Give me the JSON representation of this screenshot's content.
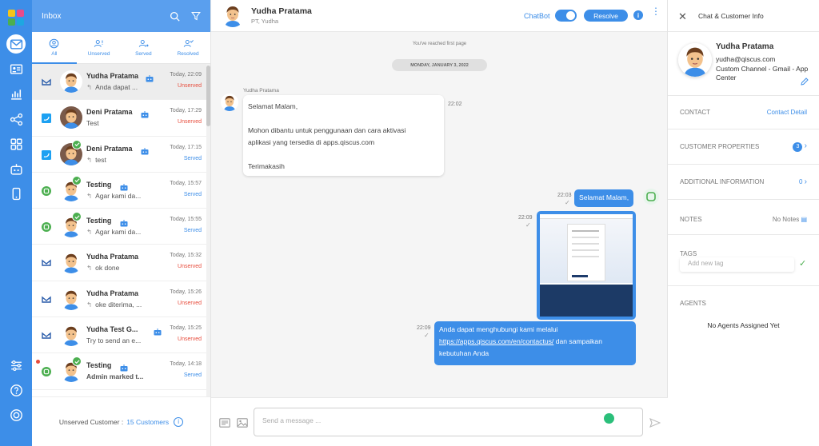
{
  "inbox": {
    "title": "Inbox",
    "tabs": [
      {
        "label": "All"
      },
      {
        "label": "Unserved"
      },
      {
        "label": "Served"
      },
      {
        "label": "Resolved"
      }
    ],
    "rows": [
      {
        "name": "Yudha Pratama",
        "channel": "gmail",
        "time": "Today, 22:09",
        "preview": "Anda dapat ...",
        "status": "Unserved",
        "reply": true,
        "selected": true,
        "bot": true
      },
      {
        "name": "Deni Pratama",
        "channel": "twitter",
        "time": "Today, 17:29",
        "preview": "Test",
        "status": "Unserved",
        "reply": false,
        "bot": true
      },
      {
        "name": "Deni Pratama",
        "channel": "twitter",
        "time": "Today, 17:15",
        "preview": "test",
        "status": "Served",
        "reply": true,
        "bot": true,
        "checked": true
      },
      {
        "name": "Testing",
        "channel": "custom",
        "time": "Today, 15:57",
        "preview": "Agar kami da...",
        "status": "Served",
        "reply": true,
        "bot": true,
        "checked": true
      },
      {
        "name": "Testing",
        "channel": "custom",
        "time": "Today, 15:55",
        "preview": "Agar kami da...",
        "status": "Served",
        "reply": true,
        "bot": true,
        "checked": true
      },
      {
        "name": "Yudha Pratama",
        "channel": "gmail",
        "time": "Today, 15:32",
        "preview": "ok done",
        "status": "Unserved",
        "reply": true,
        "bot": false
      },
      {
        "name": "Yudha Pratama",
        "channel": "gmail",
        "time": "Today, 15:26",
        "preview": "oke diterima, ...",
        "status": "Unserved",
        "reply": true,
        "bot": false
      },
      {
        "name": "Yudha Test G...",
        "channel": "gmail",
        "time": "Today, 15:25",
        "preview": "Try to send an e...",
        "status": "Unserved",
        "reply": false,
        "bot": true
      },
      {
        "name": "Testing",
        "channel": "custom",
        "time": "Today, 14:18",
        "preview": "Admin marked t...",
        "status": "Served",
        "reply": false,
        "bot": true,
        "checked": true,
        "dot": true,
        "boldPreview": true
      }
    ],
    "footer": {
      "label": "Unserved Customer :",
      "count": "15 Customers",
      "info": "i"
    }
  },
  "chat": {
    "name": "Yudha Pratama",
    "sub": "PT, Yudha",
    "chatbot_label": "ChatBot",
    "resolve_label": "Resolve",
    "info": "i",
    "more": "⋮",
    "first_page": "You've reached first page",
    "date": "MONDAY, JANUARY 3, 2022",
    "sender": "Yudha Pratama",
    "incoming": {
      "text": "Selamat Malam,\n\nMohon dibantu untuk penggunaan dan cara aktivasi\naplikasi yang tersedia di apps.qiscus.com\n\nTerimakasih",
      "time": "22:02"
    },
    "out1": {
      "text": "Selamat Malam,",
      "time": "22:03"
    },
    "out_image": {
      "time": "22:09"
    },
    "out2": {
      "text_a": "Anda dapat menghubungi kami melalui",
      "link": "https://apps.qiscus.com/en/contactus/",
      "text_b": "dan sampaikan",
      "text_c": "kebutuhan Anda",
      "time": "22:09"
    },
    "composer": {
      "placeholder": "Send a message ..."
    }
  },
  "right": {
    "title": "Chat & Customer Info",
    "close": "✕",
    "profile": {
      "name": "Yudha Pratama",
      "email": "yudha@qiscus.com",
      "channel": "Custom Channel - Gmail - App Center"
    },
    "contact": {
      "label": "CONTACT",
      "link": "Contact Detail"
    },
    "customer_properties": {
      "label": "CUSTOMER PROPERTIES",
      "count": "3"
    },
    "additional": {
      "label": "ADDITIONAL INFORMATION",
      "count": "0"
    },
    "notes": {
      "label": "NOTES",
      "value": "No Notes"
    },
    "tags": {
      "label": "TAGS",
      "placeholder": "Add new tag"
    },
    "agents": {
      "label": "AGENTS",
      "value": "No Agents Assigned Yet"
    }
  },
  "colors": {
    "accent": "#3d8ee8",
    "unserved": "#e74c3c",
    "served": "#3d8ee8",
    "green": "#4caf50"
  }
}
